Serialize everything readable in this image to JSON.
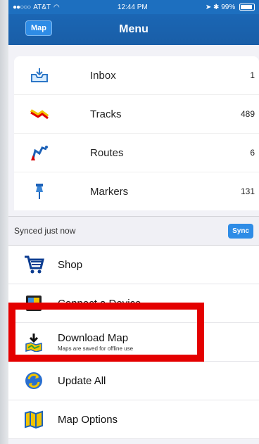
{
  "status_bar": {
    "carrier": "AT&T",
    "time": "12:44 PM",
    "battery": "99%"
  },
  "nav": {
    "map_button": "Map",
    "title": "Menu"
  },
  "library": [
    {
      "label": "Inbox",
      "count": "1",
      "icon": "inbox-icon"
    },
    {
      "label": "Tracks",
      "count": "489",
      "icon": "tracks-icon"
    },
    {
      "label": "Routes",
      "count": "6",
      "icon": "routes-icon"
    },
    {
      "label": "Markers",
      "count": "131",
      "icon": "marker-pin-icon"
    }
  ],
  "sync": {
    "status": "Synced just now",
    "button": "Sync"
  },
  "menu": [
    {
      "label": "Shop",
      "icon": "shopping-cart-icon"
    },
    {
      "label": "Connect a Device",
      "icon": "device-icon"
    },
    {
      "label": "Download Map",
      "subtitle": "Maps are saved for offline use",
      "icon": "download-map-icon"
    },
    {
      "label": "Update All",
      "icon": "update-icon"
    },
    {
      "label": "Map Options",
      "icon": "map-options-icon"
    }
  ],
  "colors": {
    "nav": "#1b66b4",
    "accent": "#2e8ce6",
    "highlight": "#e40000"
  }
}
